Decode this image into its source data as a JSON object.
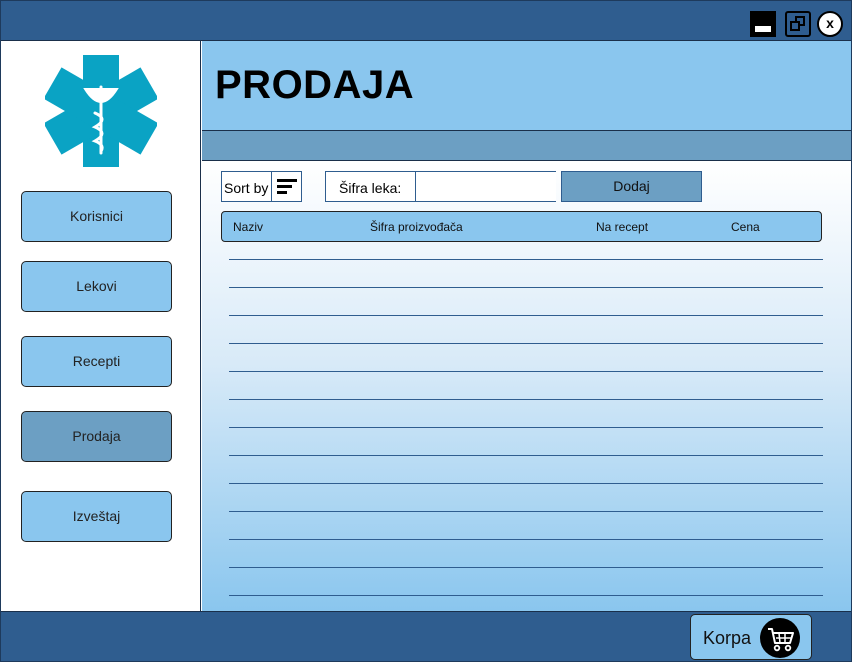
{
  "window": {
    "minimize_icon": "minimize-icon",
    "restore_icon": "restore-icon",
    "close_label": "x"
  },
  "sidebar": {
    "logo": "star-of-life-logo",
    "items": [
      {
        "label": "Korisnici",
        "active": false
      },
      {
        "label": "Lekovi",
        "active": false
      },
      {
        "label": "Recepti",
        "active": false
      },
      {
        "label": "Prodaja",
        "active": true
      },
      {
        "label": "Izveštaj",
        "active": false
      }
    ]
  },
  "header": {
    "title": "PRODAJA"
  },
  "toolbar": {
    "sort_label": "Sort by",
    "sort_icon": "sort-icon",
    "code_label": "Šifra leka:",
    "code_value": "",
    "add_label": "Dodaj"
  },
  "table": {
    "columns": [
      "Naziv",
      "Šifra proizvođača",
      "Na recept",
      "Cena"
    ],
    "rows": []
  },
  "footer": {
    "cart_label": "Korpa",
    "cart_icon": "shopping-cart-icon"
  },
  "colors": {
    "titlebar": "#2f5d8f",
    "accent_light": "#8ac6ee",
    "accent_mid": "#6c9fc3",
    "logo": "#0aa3c4"
  }
}
